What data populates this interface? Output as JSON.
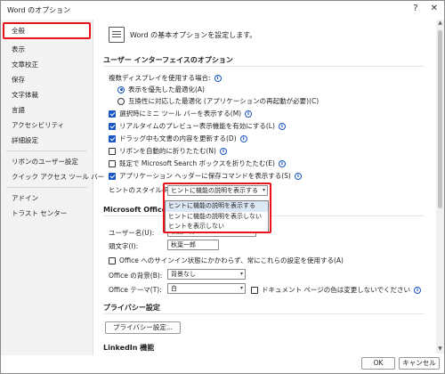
{
  "window": {
    "title": "Word のオプション"
  },
  "title_buttons": {
    "help": "?",
    "close": "✕"
  },
  "sidebar": {
    "items": [
      {
        "label": "全般",
        "selected": true
      },
      {
        "label": "表示"
      },
      {
        "label": "文章校正"
      },
      {
        "label": "保存"
      },
      {
        "label": "文字体裁"
      },
      {
        "label": "言語"
      },
      {
        "label": "アクセシビリティ"
      },
      {
        "label": "詳細設定"
      },
      {
        "label": "リボンのユーザー設定"
      },
      {
        "label": "クイック アクセス ツール バー"
      },
      {
        "label": "アドイン"
      },
      {
        "label": "トラスト センター"
      }
    ]
  },
  "main": {
    "header": "Word の基本オプションを設定します。",
    "ui_section": {
      "title": "ユーザー インターフェイスのオプション",
      "multi_display_label": "複数ディスプレイを使用する場合:",
      "radio_optimize": "表示を優先した最適化(A)",
      "radio_compat": "互換性に対応した最適化 (アプリケーションの再起動が必要)(C)",
      "cb_mini_toolbar": "選択時にミニ ツール バーを表示する(M)",
      "cb_live_preview": "リアルタイムのプレビュー表示機能を有効にする(L)",
      "cb_drag_update": "ドラッグ中も文書の内容を更新する(D)",
      "cb_collapse_ribbon": "リボンを自動的に折りたたむ(N)",
      "cb_collapse_search": "既定で Microsoft Search ボックスを折りたたむ(E)",
      "cb_show_save": "アプリケーション ヘッダーに保存コマンドを表示する(S)",
      "tip_style_label": "ヒントのスタイル(R):",
      "tip_style_value": "ヒントに機能の説明を表示する",
      "tip_options": [
        "ヒントに機能の説明を表示する",
        "ヒントに機能の説明を表示しない",
        "ヒントを表示しない"
      ]
    },
    "office_section": {
      "title": "Microsoft Office のユーザー設定",
      "username_label": "ユーザー名(U):",
      "username_value": "秋葉一郎",
      "initials_label": "頭文字(I):",
      "initials_value": "秋葉一郎",
      "cb_always_use": "Office へのサインイン状態にかかわらず、常にこれらの設定を使用する(A)",
      "background_label": "Office の背景(B):",
      "background_value": "背景なし",
      "theme_label": "Office テーマ(T):",
      "theme_value": "白",
      "cb_no_change_page": "ドキュメント ページの色は変更しないでください"
    },
    "privacy_section": {
      "title": "プライバシー設定",
      "button": "プライバシー設定..."
    },
    "linkedin_section": {
      "title": "LinkedIn 機能"
    }
  },
  "footer": {
    "ok": "OK",
    "cancel": "キャンセル"
  },
  "colors": {
    "accent": "#1a56c4",
    "highlight_border": "#e8121c"
  }
}
